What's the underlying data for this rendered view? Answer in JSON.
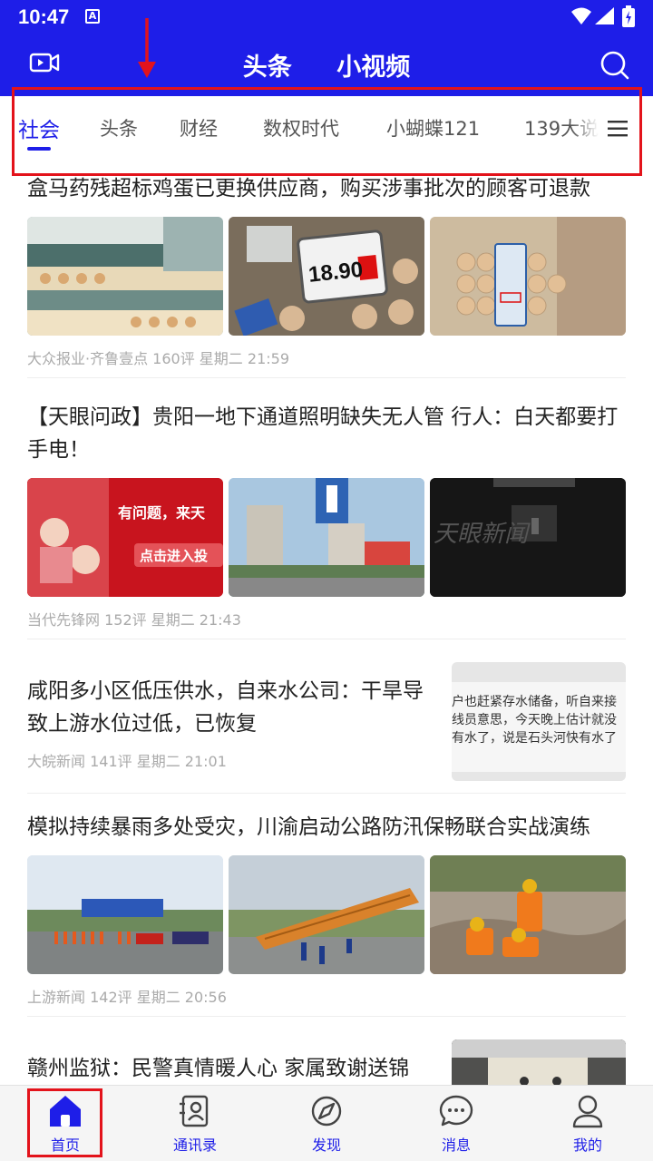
{
  "status_bar": {
    "time": "10:47",
    "notif_glyph": "A"
  },
  "header": {
    "tabs": [
      "头条",
      "小视频"
    ]
  },
  "channels": {
    "items": [
      "社会",
      "头条",
      "财经",
      "数权时代",
      "小蝴蝶121",
      "139大说"
    ],
    "active_index": 0
  },
  "articles": [
    {
      "title": "盒马药残超标鸡蛋已更换供应商，购买涉事批次的顾客可退款",
      "meta": "大众报业·齐鲁壹点 160评 星期二 21:59",
      "price_tag": "18.90"
    },
    {
      "title": "【天眼问政】贵阳一地下通道照明缺失无人管 行人：白天都要打手电！",
      "meta": "当代先锋网 152评 星期二 21:43",
      "banner_line1": "有问题，来天",
      "banner_line2": "点击进入投",
      "watermark": "天眼新闻"
    },
    {
      "title": "咸阳多小区低压供水，自来水公司：干旱导致上游水位过低，已恢复",
      "meta": "大皖新闻 141评 星期二 21:01",
      "thumb_text": "户也赶紧存水储备，听自来接线员意思，今天晚上估计就没有水了，说是石头河快有水了"
    },
    {
      "title": "模拟持续暴雨多处受灾，川渝启动公路防汛保畅联合实战演练",
      "meta": "上游新闻 142评 星期二 20:56"
    },
    {
      "title": "赣州监狱：民警真情暖人心 家属致谢送锦",
      "meta": ""
    }
  ],
  "bottom_nav": {
    "items": [
      "首页",
      "通讯录",
      "发现",
      "消息",
      "我的"
    ],
    "active_index": 0
  },
  "colors": {
    "brand": "#1e1ee8",
    "annotation": "#e3131b"
  }
}
